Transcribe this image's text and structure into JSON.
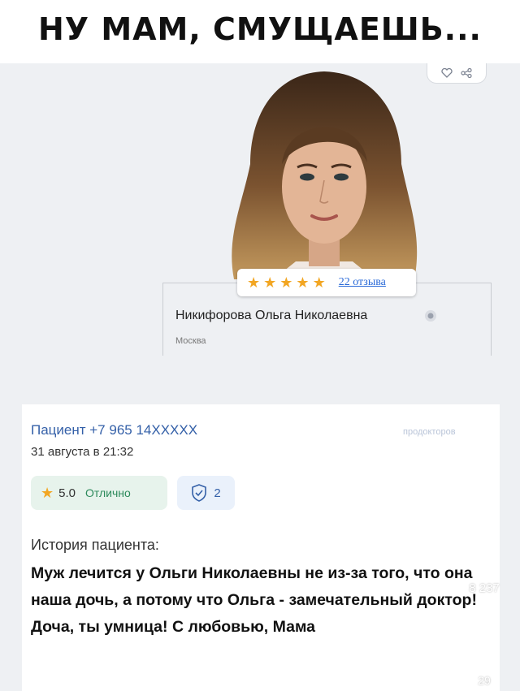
{
  "meme": {
    "caption": "НУ МАМ, СМУЩАЕШЬ..."
  },
  "doctor": {
    "rating_stars": 5,
    "reviews_link": "22 отзыва",
    "name": "Никифорова Ольга Николаевна",
    "city": "Москва"
  },
  "review": {
    "patient": "Пациент +7 965 14XXXXX",
    "brand": "продокторов",
    "date": "31 августа в 21:32",
    "score": "5.0",
    "score_text": "Отлично",
    "verified_count": "2",
    "history_label": "История пациента:",
    "text": "Муж лечится у Ольги Николаевны не из-за того, что она наша дочь, а потому что Ольга - замечательный доктор! Доча, ты умница! С любовью, Мама"
  },
  "social": {
    "likes": "8 237",
    "comments": "29"
  },
  "icons": {
    "heart": "heart-icon",
    "share": "share-icon",
    "star": "star-icon",
    "verified": "verified-icon",
    "shield": "shield-check-icon",
    "comment": "comment-icon"
  },
  "colors": {
    "star": "#f2a623",
    "link": "#2a6ad8",
    "patient": "#3460a8",
    "score_text": "#2d8a5c"
  }
}
